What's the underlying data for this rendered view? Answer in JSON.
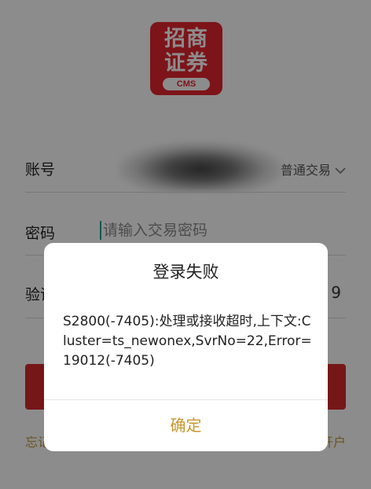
{
  "logo": {
    "line1": "招商",
    "line2": "证券",
    "badge": "CMS"
  },
  "form": {
    "account_label": "账号",
    "account_type": "普通交易",
    "password_label": "密码",
    "password_placeholder": "请输入交易密码",
    "code_label": "验证码",
    "code_value": "9"
  },
  "bottom": {
    "left_link": "忘记密码",
    "right_link": "开户"
  },
  "dialog": {
    "title": "登录失败",
    "message": "S2800(-7405):处理或接收超时,上下文:Cluster=ts_newonex,SvrNo=22,Error=19012(-7405)",
    "confirm_label": "确定"
  },
  "colors": {
    "brand_red": "#e3262f",
    "accent_gold": "#c8962f",
    "overlay": "rgba(0,0,0,0.45)"
  }
}
